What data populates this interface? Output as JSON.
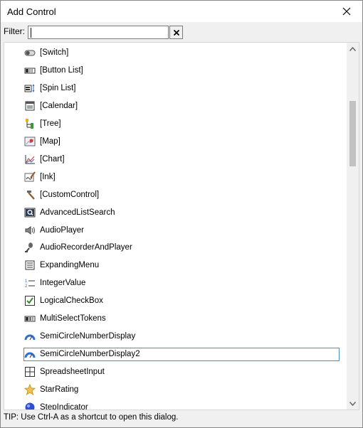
{
  "window": {
    "title": "Add Control"
  },
  "filter": {
    "label": "Filter:",
    "value": ""
  },
  "items": [
    {
      "label": "[Switch]",
      "icon": "switch-icon"
    },
    {
      "label": "[Button List]",
      "icon": "button-list-icon"
    },
    {
      "label": "[Spin List]",
      "icon": "spin-list-icon"
    },
    {
      "label": "[Calendar]",
      "icon": "calendar-icon"
    },
    {
      "label": "[Tree]",
      "icon": "tree-icon"
    },
    {
      "label": "[Map]",
      "icon": "map-icon"
    },
    {
      "label": "[Chart]",
      "icon": "chart-icon"
    },
    {
      "label": "[Ink]",
      "icon": "ink-icon"
    },
    {
      "label": "[CustomControl]",
      "icon": "hammer-icon"
    },
    {
      "label": "AdvancedListSearch",
      "icon": "search-list-icon"
    },
    {
      "label": "AudioPlayer",
      "icon": "speaker-icon"
    },
    {
      "label": "AudioRecorderAndPlayer",
      "icon": "microphone-icon"
    },
    {
      "label": "ExpandingMenu",
      "icon": "menu-icon"
    },
    {
      "label": "IntegerValue",
      "icon": "numbered-list-icon"
    },
    {
      "label": "LogicalCheckBox",
      "icon": "checkbox-icon"
    },
    {
      "label": "MultiSelectTokens",
      "icon": "tokens-icon"
    },
    {
      "label": "SemiCircleNumberDisplay",
      "icon": "semicircle-gauge-icon"
    },
    {
      "label": "SemiCircleNumberDisplay2",
      "icon": "semicircle-gauge-icon",
      "selected": true
    },
    {
      "label": "SpreadsheetInput",
      "icon": "grid-icon"
    },
    {
      "label": "StarRating",
      "icon": "star-icon"
    },
    {
      "label": "StepIndicator",
      "icon": "blue-circle-icon"
    }
  ],
  "tip": "TIP: Use Ctrl-A as a shortcut to open this dialog.",
  "colors": {
    "selection_border": "#4a90c2",
    "star": "#f2c14e",
    "check": "#2e8b2e",
    "gauge": "#2f6fd0"
  }
}
